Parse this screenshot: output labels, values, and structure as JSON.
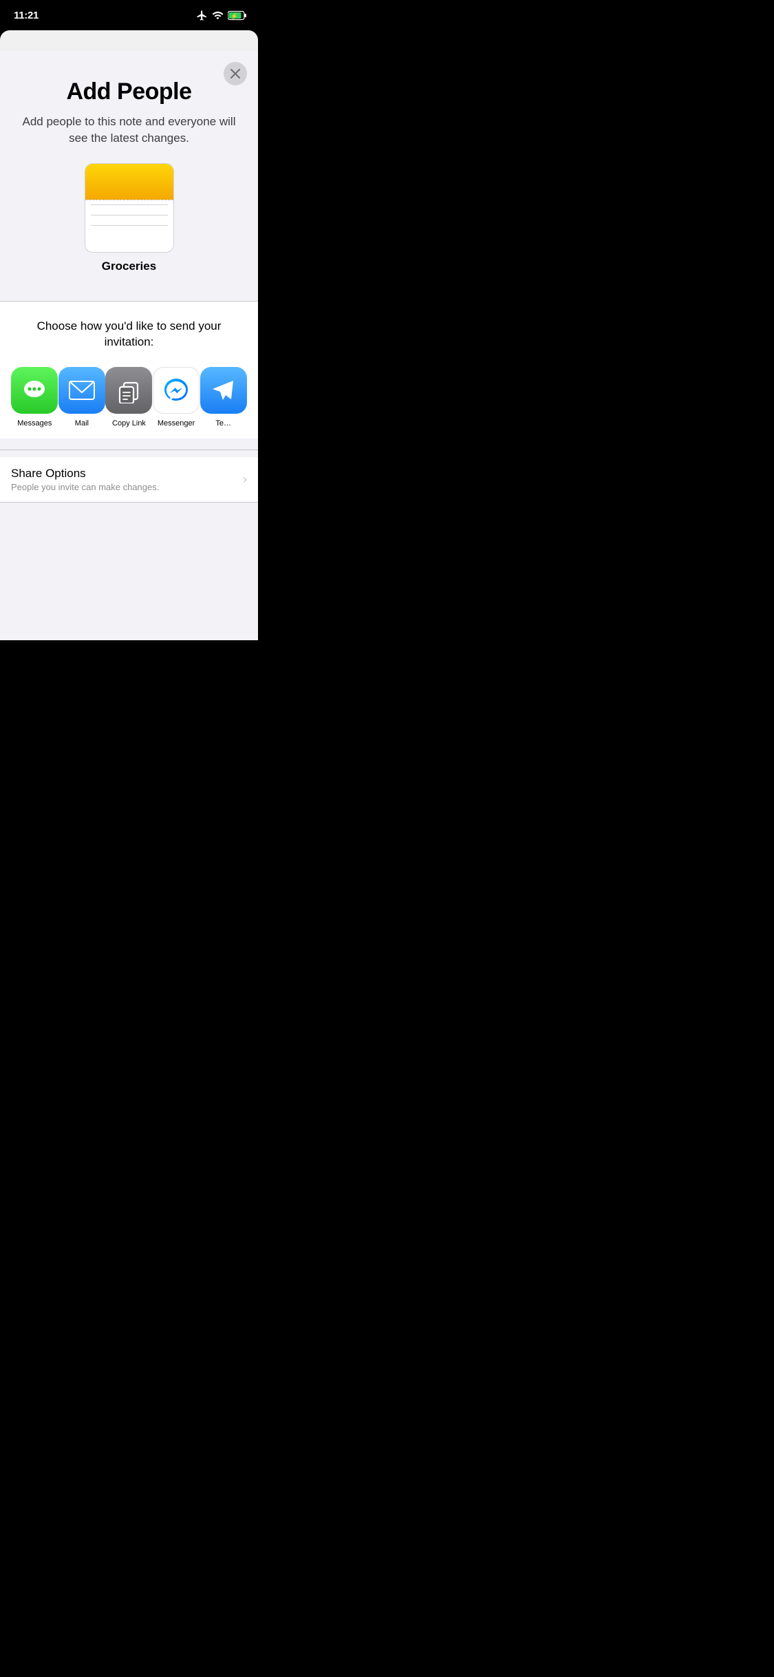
{
  "statusBar": {
    "time": "11:21",
    "airplaneMode": true,
    "wifi": true,
    "battery": "charging"
  },
  "modal": {
    "title": "Add People",
    "subtitle": "Add people to this note and everyone will see the latest changes.",
    "noteName": "Groceries",
    "closeButton": "×",
    "sharePrompt": "Choose how you'd like to send your invitation:",
    "shareOptions": [
      {
        "id": "messages",
        "label": "Messages",
        "iconType": "messages"
      },
      {
        "id": "mail",
        "label": "Mail",
        "iconType": "mail"
      },
      {
        "id": "copy-link",
        "label": "Copy Link",
        "iconType": "copy-link"
      },
      {
        "id": "messenger",
        "label": "Messenger",
        "iconType": "messenger"
      },
      {
        "id": "telegram",
        "label": "Te…",
        "iconType": "telegram"
      }
    ],
    "shareOptionsSection": {
      "title": "Share Options",
      "subtitle": "People you invite can make changes."
    }
  }
}
